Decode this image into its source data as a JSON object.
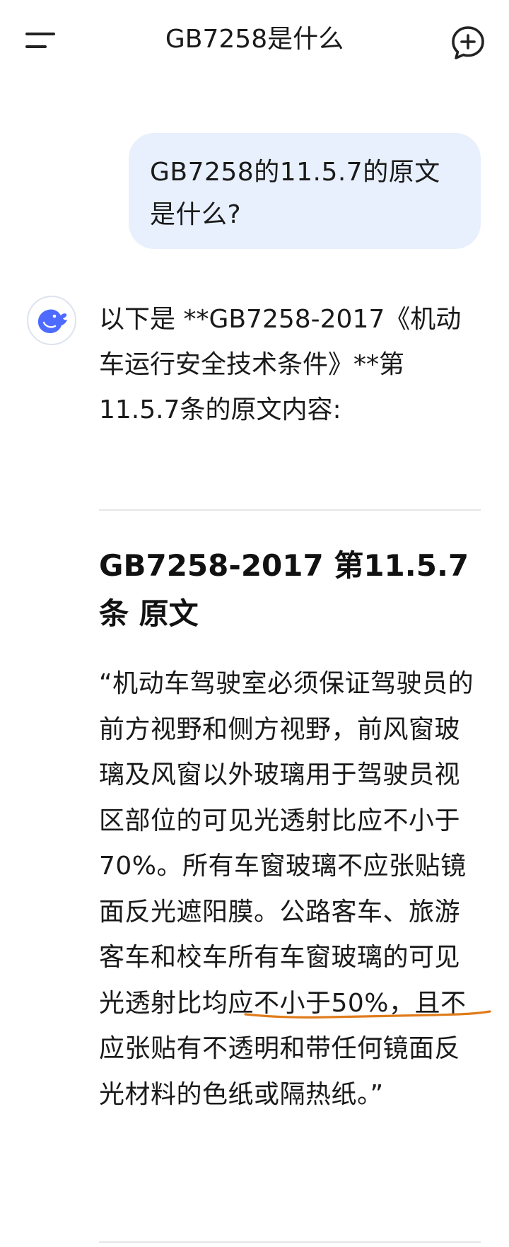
{
  "header": {
    "title": "GB7258是什么",
    "menu_icon": "hamburger-menu-icon",
    "new_chat_icon": "chat-plus-icon"
  },
  "user_message": {
    "text": "GB7258的11.5.7的原文是什么?"
  },
  "assistant": {
    "avatar_icon": "whale-logo-icon",
    "intro": "以下是 **GB7258-2017《机动车运行安全技术条件》**第11.5.7条的原文内容:",
    "heading": "GB7258-2017 第11.5.7条 原文",
    "quote": "“机动车驾驶室必须保证驾驶员的前方视野和侧方视野，前风窗玻璃及风窗以外玻璃用于驾驶员视区部位的可见光透射比应不小于70%。所有车窗玻璃不应张贴镜面反光遮阳膜。公路客车、旅游客车和校车所有车窗玻璃的可见光透射比均应不小于50%，且不应张贴有不透明和带任何镜面反光材料的色纸或隔热纸。”"
  },
  "colors": {
    "bubble_bg": "#e8f0fd",
    "accent_blue": "#4d6bfe",
    "annotation_orange": "#e07b1a"
  }
}
